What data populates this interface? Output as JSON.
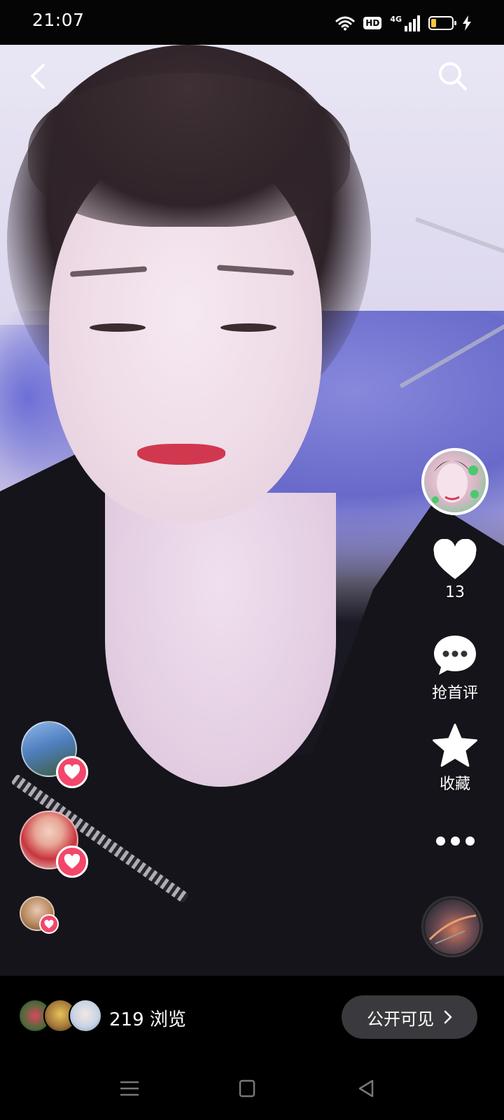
{
  "status_bar": {
    "time": "21:07",
    "hd_label": "HD",
    "network_label": "4G",
    "battery_level": 0.25,
    "icons": [
      "wifi-icon",
      "hd-icon",
      "signal-4g-icon",
      "battery-icon",
      "charging-bolt-icon"
    ]
  },
  "top_nav": {
    "back_icon": "chevron-left-icon",
    "search_icon": "search-icon"
  },
  "actions": {
    "like_count": "13",
    "comment_label": "抢首评",
    "favorite_label": "收藏",
    "more_icon": "more-dots-icon"
  },
  "bottom_bar": {
    "view_count": "219",
    "views_suffix": "浏览",
    "visibility_label": "公开可见"
  },
  "colors": {
    "heart_badge": "#f3466a",
    "pill_bg": "#3a3a3e",
    "battery_fill": "#f5c542"
  }
}
